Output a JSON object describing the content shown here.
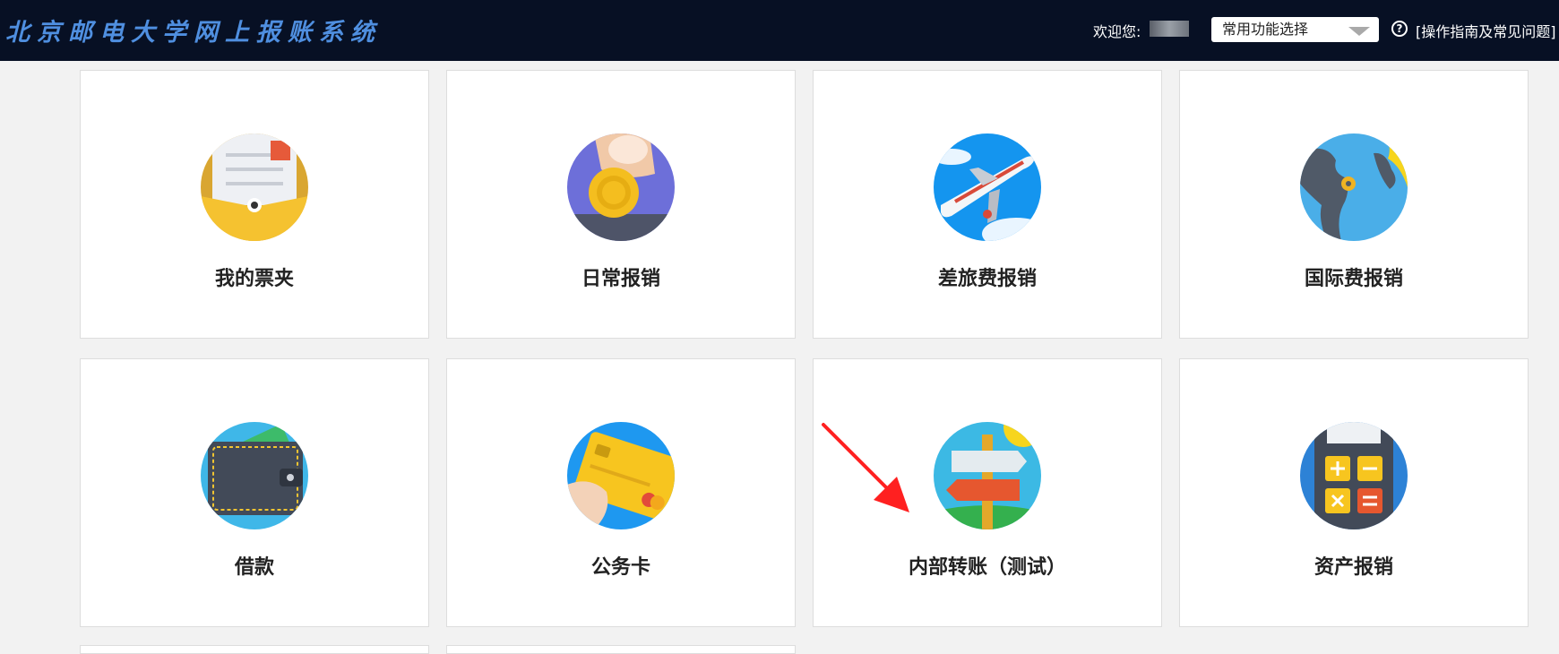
{
  "header": {
    "title": "北京邮电大学网上报账系统",
    "welcome": "欢迎您:",
    "function_select": "常用功能选择",
    "help_link": "[操作指南及常见问题]"
  },
  "cards": [
    {
      "label": "我的票夹",
      "icon": "ticket-folder-icon"
    },
    {
      "label": "日常报销",
      "icon": "coin-icon"
    },
    {
      "label": "差旅费报销",
      "icon": "airplane-icon"
    },
    {
      "label": "国际费报销",
      "icon": "globe-icon"
    },
    {
      "label": "借款",
      "icon": "wallet-icon"
    },
    {
      "label": "公务卡",
      "icon": "credit-card-icon"
    },
    {
      "label": "内部转账（测试）",
      "icon": "signpost-icon"
    },
    {
      "label": "资产报销",
      "icon": "calculator-icon"
    }
  ]
}
